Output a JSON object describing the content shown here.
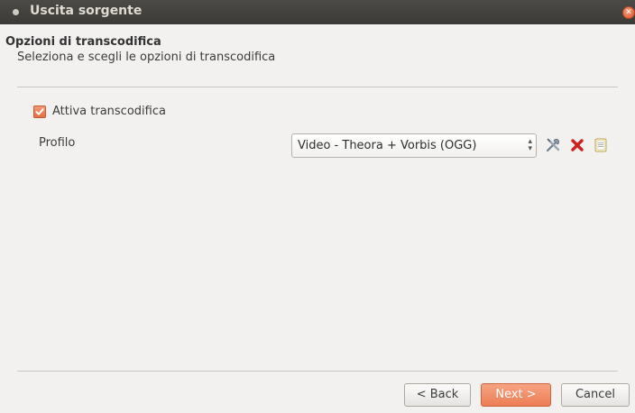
{
  "window": {
    "title": "Uscita sorgente"
  },
  "header": {
    "title": "Opzioni di transcodifica",
    "subtitle": "Seleziona e scegli le opzioni di transcodifica"
  },
  "transcode": {
    "checkbox_label": "Attiva transcodifica",
    "checked": true
  },
  "profile": {
    "label": "Profilo",
    "selected": "Video - Theora + Vorbis (OGG)"
  },
  "icons": {
    "edit": "tools-icon",
    "delete": "delete-icon",
    "new": "new-profile-icon"
  },
  "footer": {
    "back_label": "< Back",
    "next_label": "Next >",
    "cancel_label": "Cancel"
  },
  "colors": {
    "accent": "#e9764b",
    "titlebar": "#3e3d39",
    "delete": "#d01f1f"
  }
}
